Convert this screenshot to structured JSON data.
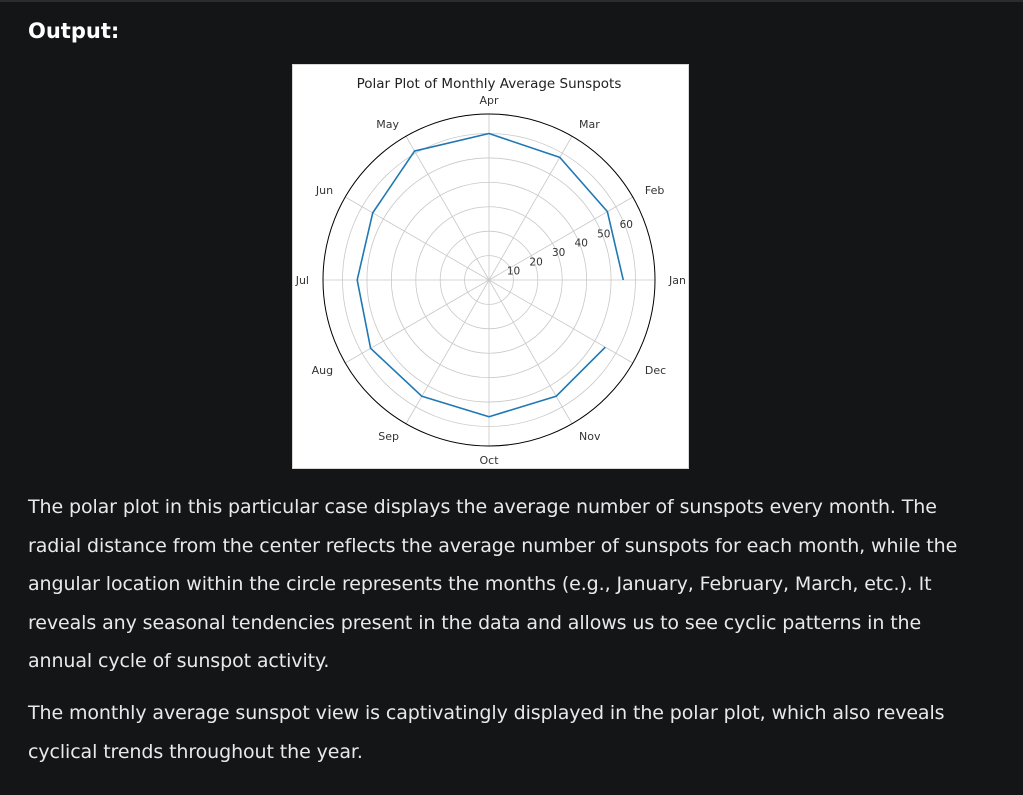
{
  "page": {
    "heading": "Output:",
    "paragraphs": [
      "The polar plot in this particular case displays the average number of sunspots every month. The radial distance from the center reflects the average number of sunspots for each month, while the angular location within the circle represents the months (e.g., January, February, March, etc.). It reveals any seasonal tendencies present in the data and allows us to see cyclic patterns in the annual cycle of sunspot activity.",
      "The monthly average sunspot view is captivatingly displayed in the polar plot, which also reveals cyclical trends throughout the year."
    ]
  },
  "colors": {
    "background": "#141517",
    "text": "#e9e9e9",
    "heading": "#ffffff",
    "series": "#1f77b4"
  },
  "chart_data": {
    "type": "line",
    "projection": "polar",
    "title": "Polar Plot of Monthly Average Sunspots",
    "months": [
      "Jan",
      "Feb",
      "Mar",
      "Apr",
      "May",
      "Jun",
      "Jul",
      "Aug",
      "Sep",
      "Oct",
      "Nov",
      "Dec"
    ],
    "series": [
      {
        "values": [
          55,
          56,
          58,
          60,
          61,
          55,
          54,
          56,
          55,
          56,
          55,
          55
        ]
      }
    ],
    "radial_ticks": [
      10,
      20,
      30,
      40,
      50,
      60
    ],
    "rlim": [
      0,
      68
    ],
    "grid": true,
    "closed": false
  }
}
